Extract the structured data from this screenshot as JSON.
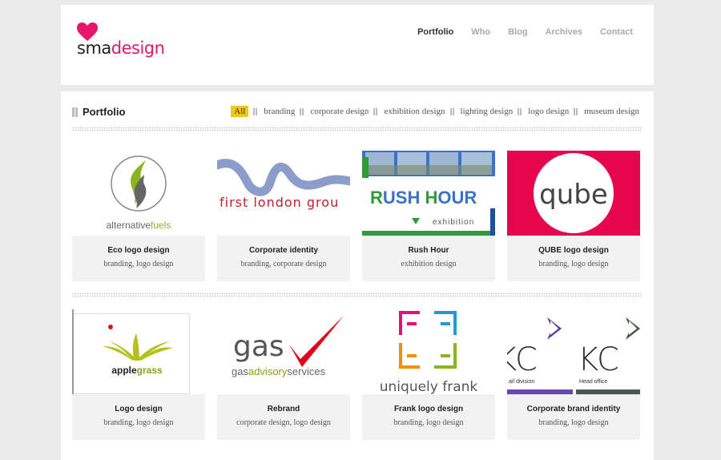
{
  "brand": {
    "part1": "sma",
    "part2": "design",
    "accent": "#e8166b"
  },
  "nav": [
    {
      "label": "Portfolio",
      "active": true
    },
    {
      "label": "Who"
    },
    {
      "label": "Blog"
    },
    {
      "label": "Archives"
    },
    {
      "label": "Contact"
    }
  ],
  "section": {
    "title": "Portfolio"
  },
  "filters": [
    "All",
    "branding",
    "corporate design",
    "exhibition design",
    "lighting design",
    "logo design",
    "museum design"
  ],
  "filter_active_color": "#f0c61a",
  "thumbs": {
    "alt": {
      "word1": "alternative",
      "word2": "fuels"
    },
    "london": "first london grou",
    "rush": {
      "title1": "R",
      "title2": "USH ",
      "title3": "H",
      "title4": "OUR",
      "sub": "exhibition"
    },
    "qube": "qube",
    "apple": {
      "w1": "apple",
      "w2": "grass"
    },
    "gas": {
      "big": "gas",
      "small1": "gas",
      "small2": "advisory",
      "small3": "services"
    },
    "frank": "uniquely frank",
    "kc": {
      "left": "KC",
      "right": "KC",
      "cap1": "ail division",
      "cap2": "Head office"
    }
  },
  "portfolio": [
    {
      "title": "Eco logo design",
      "cats": "branding, logo design"
    },
    {
      "title": "Corporate identity",
      "cats": "branding, corporate design"
    },
    {
      "title": "Rush Hour",
      "cats": "exhibition design"
    },
    {
      "title": "QUBE logo design",
      "cats": "branding, logo design"
    },
    {
      "title": "Logo design",
      "cats": "branding, logo design"
    },
    {
      "title": "Rebrand",
      "cats": "corporate design, logo design"
    },
    {
      "title": "Frank logo design",
      "cats": "branding, logo design"
    },
    {
      "title": "Corporate brand identity",
      "cats": "branding, logo design"
    }
  ]
}
